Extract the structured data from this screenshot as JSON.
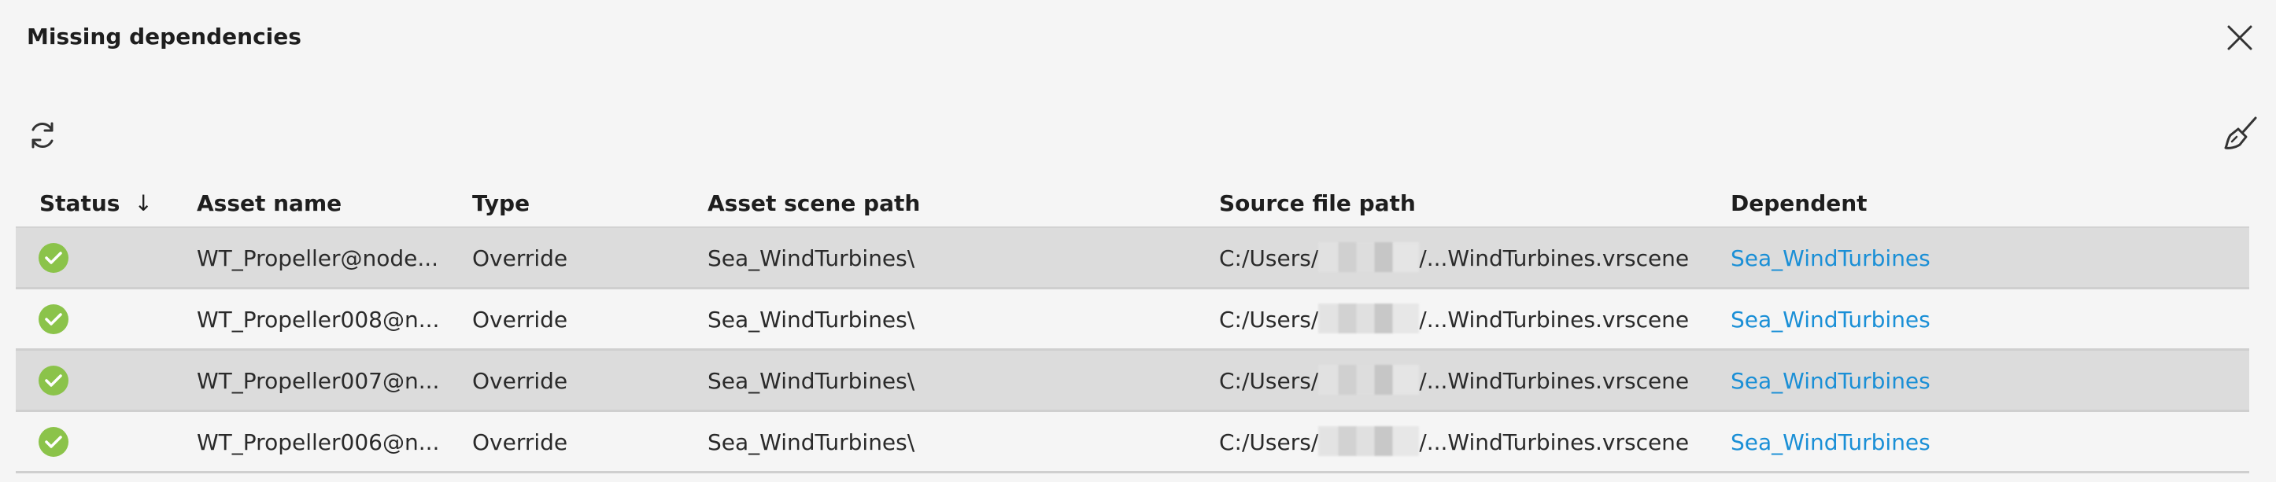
{
  "dialog": {
    "title": "Missing dependencies"
  },
  "icons": {
    "close": "close-icon",
    "refresh": "refresh-icon",
    "cleanup": "broom-icon",
    "status_ok": "check-circle-icon"
  },
  "colors": {
    "ok": "#8bc34a",
    "link": "#1a8fd6",
    "row_alt": "#dcdcdc"
  },
  "table": {
    "columns": [
      {
        "label": "Status",
        "sort": "↓"
      },
      {
        "label": "Asset name"
      },
      {
        "label": "Type"
      },
      {
        "label": "Asset scene path"
      },
      {
        "label": "Source file path"
      },
      {
        "label": "Dependent"
      }
    ],
    "rows": [
      {
        "asset_name": "WT_Propeller@node...",
        "type": "Override",
        "scene_path": "Sea_WindTurbines\\",
        "source_prefix": "C:/Users/",
        "source_suffix": "/...WindTurbines.vrscene",
        "dependent": "Sea_WindTurbines"
      },
      {
        "asset_name": "WT_Propeller008@n...",
        "type": "Override",
        "scene_path": "Sea_WindTurbines\\",
        "source_prefix": "C:/Users/",
        "source_suffix": "/...WindTurbines.vrscene",
        "dependent": "Sea_WindTurbines"
      },
      {
        "asset_name": "WT_Propeller007@n...",
        "type": "Override",
        "scene_path": "Sea_WindTurbines\\",
        "source_prefix": "C:/Users/",
        "source_suffix": "/...WindTurbines.vrscene",
        "dependent": "Sea_WindTurbines"
      },
      {
        "asset_name": "WT_Propeller006@n...",
        "type": "Override",
        "scene_path": "Sea_WindTurbines\\",
        "source_prefix": "C:/Users/",
        "source_suffix": "/...WindTurbines.vrscene",
        "dependent": "Sea_WindTurbines"
      }
    ]
  }
}
